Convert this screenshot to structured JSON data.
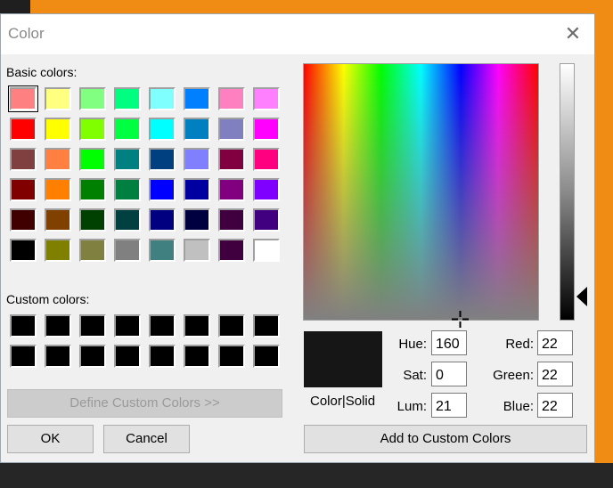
{
  "window": {
    "title": "Color"
  },
  "labels": {
    "basic_colors": "Basic colors:",
    "custom_colors": "Custom colors:",
    "color_solid": "Color|Solid"
  },
  "icons": {
    "close": "close-icon",
    "crosshair": "crosshair-icon",
    "luminance_arrow": "arrow-left-icon"
  },
  "basic_colors": [
    [
      "#ff8080",
      "#ffff80",
      "#80ff80",
      "#00ff80",
      "#80ffff",
      "#0080ff",
      "#ff80c0",
      "#ff80ff"
    ],
    [
      "#ff0000",
      "#ffff00",
      "#80ff00",
      "#00ff40",
      "#00ffff",
      "#0080c0",
      "#8080c0",
      "#ff00ff"
    ],
    [
      "#804040",
      "#ff8040",
      "#00ff00",
      "#008080",
      "#004080",
      "#8080ff",
      "#800040",
      "#ff0080"
    ],
    [
      "#800000",
      "#ff8000",
      "#008000",
      "#008040",
      "#0000ff",
      "#0000a0",
      "#800080",
      "#8000ff"
    ],
    [
      "#400000",
      "#804000",
      "#004000",
      "#004040",
      "#000080",
      "#000040",
      "#400040",
      "#400080"
    ],
    [
      "#000000",
      "#808000",
      "#808040",
      "#808080",
      "#408080",
      "#c0c0c0",
      "#400040",
      "#ffffff"
    ]
  ],
  "selected_basic_color": "#ff8080",
  "custom_colors": [
    [
      "#000000",
      "#000000",
      "#000000",
      "#000000",
      "#000000",
      "#000000",
      "#000000",
      "#000000"
    ],
    [
      "#000000",
      "#000000",
      "#000000",
      "#000000",
      "#000000",
      "#000000",
      "#000000",
      "#000000"
    ]
  ],
  "preview_color": "#161616",
  "buttons": {
    "define_custom": "Define Custom Colors >>",
    "ok": "OK",
    "cancel": "Cancel",
    "add_custom": "Add to Custom Colors"
  },
  "fields": {
    "hue": {
      "label": "Hue:",
      "value": "160"
    },
    "sat": {
      "label": "Sat:",
      "value": "0"
    },
    "lum": {
      "label": "Lum:",
      "value": "21"
    },
    "red": {
      "label": "Red:",
      "value": "22"
    },
    "green": {
      "label": "Green:",
      "value": "22"
    },
    "blue": {
      "label": "Blue:",
      "value": "22"
    }
  }
}
